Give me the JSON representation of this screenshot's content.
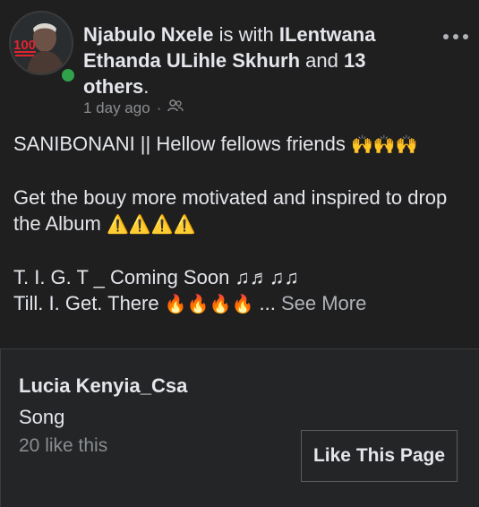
{
  "post": {
    "author": "Njabulo Nxele",
    "connector": "is with",
    "tagged": "ILentwana Ethanda ULihle Skhurh",
    "and_text": "and",
    "others": "13 others",
    "period": ".",
    "time": "1 day ago",
    "separator": "·",
    "avatar_text": "100",
    "body": {
      "line1": "SANIBONANI || Hellow fellows friends",
      "line1_emoji": "🙌🙌🙌",
      "line2": "Get the bouy more motivated and inspired to drop the Album",
      "line2_emoji": "⚠️⚠️⚠️⚠️",
      "line3": "T. I. G. T _ Coming Soon ♫♬♫♫",
      "line4": "Till. I. Get. There",
      "line4_emoji": "🔥🔥🔥🔥",
      "ellipsis": "...",
      "see_more": "See More"
    }
  },
  "page_card": {
    "name": "Lucia Kenyia_Csa",
    "category": "Song",
    "likes": "20 like this",
    "button": "Like This Page"
  },
  "colors": {
    "background": "#1f1f20",
    "card": "#242526",
    "online": "#31a24c",
    "secondary_text": "#8a8d91"
  },
  "icons": {
    "more": "more-dots-icon",
    "audience": "friends-audience-icon"
  }
}
